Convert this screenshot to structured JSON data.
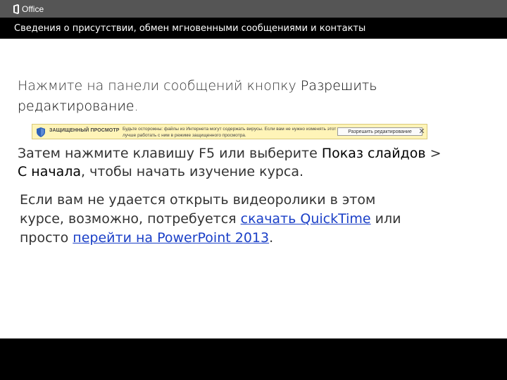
{
  "app": {
    "logo_text": "Office"
  },
  "header": {
    "title": "Сведения о присутствии, обмен мгновенными сообщениями и контакты"
  },
  "step1": {
    "text": "Нажмите на панели сообщений кнопку ",
    "emph": "Разрешить редактирование",
    "end": "."
  },
  "message_bar": {
    "title": "ЗАЩИЩЕННЫЙ ПРОСМОТР",
    "text": "Будьте осторожны: файлы из Интернета могут содержать вирусы. Если вам не нужно изменять этот документ, лучше работать с ним в режиме защищенного просмотра.",
    "button_label": "Разрешить редактирование",
    "close_glyph": "✕",
    "color": "#fff4b8"
  },
  "step2": {
    "text": "Затем нажмите клавишу F5 или выберите ",
    "emph1": "Показ слайдов",
    "sep": " > ",
    "emph2": "С начала",
    "end": ", чтобы начать изучение курса."
  },
  "note": {
    "text1": "Если вам не удается открыть видеоролики в этом курсе, возможно, потребуется ",
    "link1": "скачать QuickTime",
    "text2": " или просто ",
    "link2": "перейти на PowerPoint 2013",
    "end": "."
  }
}
